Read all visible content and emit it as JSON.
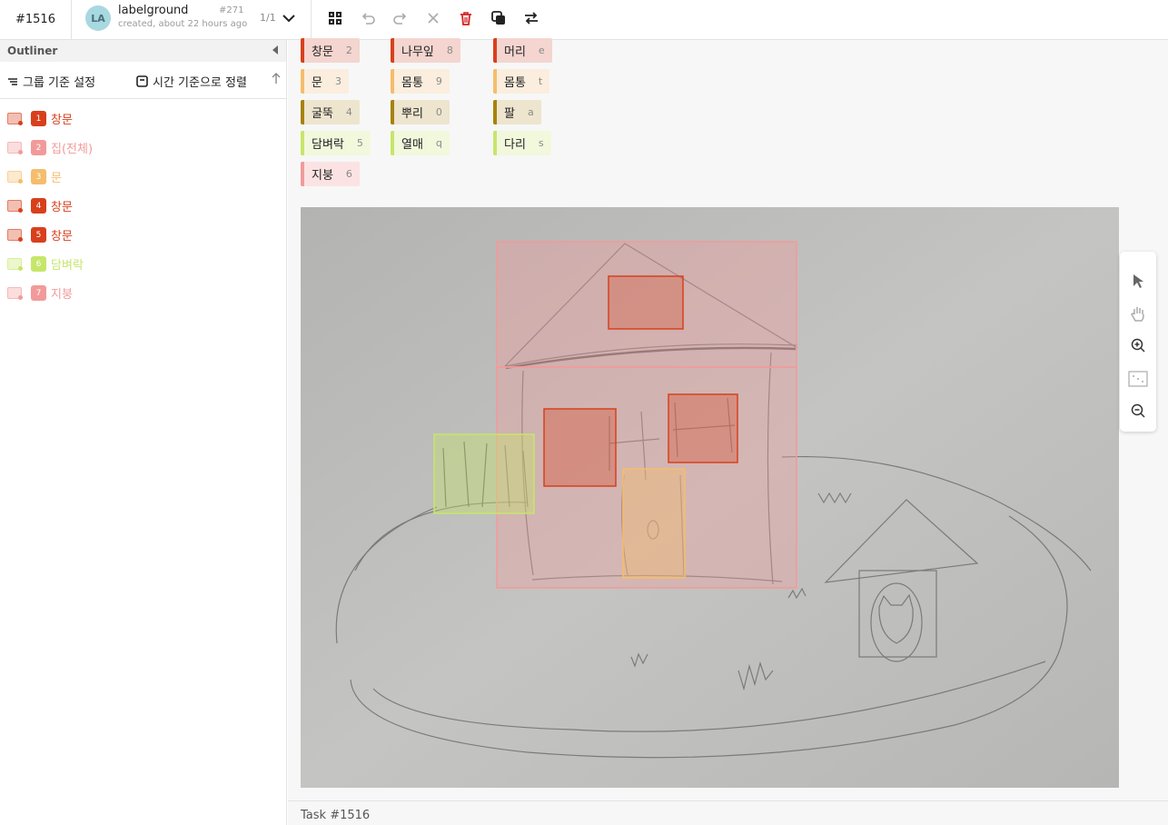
{
  "header": {
    "task_id": "#1516",
    "avatar_initials": "LA",
    "user_name": "labelground",
    "created": "created, about 22 hours ago",
    "annotation_id": "#271",
    "pager": "1/1"
  },
  "toolbar": {
    "icons": [
      "grid-icon",
      "undo-icon",
      "redo-icon",
      "close-icon",
      "delete-icon",
      "copy-icon",
      "swap-icon"
    ]
  },
  "outliner": {
    "title": "Outliner",
    "group_label": "그룹 기준 설정",
    "sort_label": "시간 기준으로 정렬",
    "items": [
      {
        "num": "1",
        "label": "창문",
        "color": "#d8401c"
      },
      {
        "num": "2",
        "label": "집(전체)",
        "color": "#f29a9a"
      },
      {
        "num": "3",
        "label": "문",
        "color": "#f5bd6c"
      },
      {
        "num": "4",
        "label": "창문",
        "color": "#d8401c"
      },
      {
        "num": "5",
        "label": "창문",
        "color": "#d8401c"
      },
      {
        "num": "6",
        "label": "담벼락",
        "color": "#c6e66a"
      },
      {
        "num": "7",
        "label": "지붕",
        "color": "#f29a9a"
      }
    ]
  },
  "classes": [
    {
      "label": "창문",
      "key": "2",
      "color": "#d8401c",
      "bg": "#f4d5cf"
    },
    {
      "label": "문",
      "key": "3",
      "color": "#f5bd6c",
      "bg": "#fbeede"
    },
    {
      "label": "굴뚝",
      "key": "4",
      "color": "#a8820a",
      "bg": "#eee5cf"
    },
    {
      "label": "담벼락",
      "key": "5",
      "color": "#c6e66a",
      "bg": "#f2f8dc"
    },
    {
      "label": "지붕",
      "key": "6",
      "color": "#f29a9a",
      "bg": "#fbe3e3"
    },
    {
      "label": "나무잎",
      "key": "8",
      "color": "#d8401c",
      "bg": "#f4d5cf"
    },
    {
      "label": "몸통",
      "key": "9",
      "color": "#f5bd6c",
      "bg": "#fbeede"
    },
    {
      "label": "뿌리",
      "key": "0",
      "color": "#a8820a",
      "bg": "#eee5cf"
    },
    {
      "label": "열매",
      "key": "q",
      "color": "#c6e66a",
      "bg": "#f2f8dc"
    },
    {
      "label": "머리",
      "key": "e",
      "color": "#d8401c",
      "bg": "#f4d5cf"
    },
    {
      "label": "몸통",
      "key": "t",
      "color": "#f5bd6c",
      "bg": "#fbeede"
    },
    {
      "label": "팔",
      "key": "a",
      "color": "#a8820a",
      "bg": "#eee5cf"
    },
    {
      "label": "다리",
      "key": "s",
      "color": "#c6e66a",
      "bg": "#f2f8dc"
    }
  ],
  "viewer_tools": [
    "pointer-icon",
    "hand-icon",
    "zoom-in-icon",
    "fit-icon",
    "zoom-out-icon"
  ],
  "footer": {
    "task": "Task #1516"
  }
}
